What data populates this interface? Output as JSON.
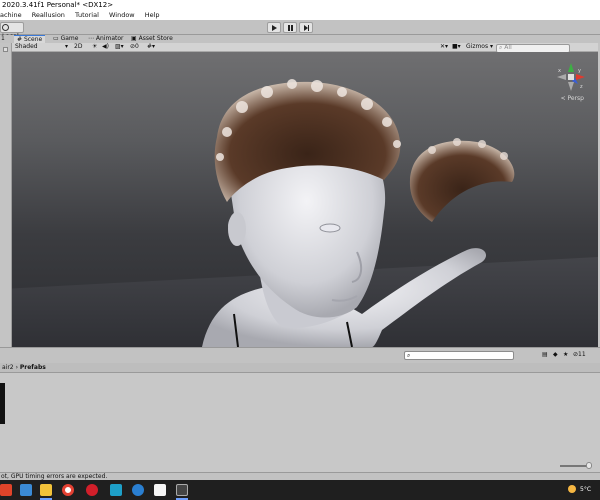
{
  "window": {
    "title": "2020.3.41f1 Personal* <DX12>"
  },
  "menu": {
    "items": [
      "achine",
      "Reallusion",
      "Tutorial",
      "Window",
      "Help"
    ]
  },
  "toolbar": {
    "local_label": "Local",
    "layers_value": "1"
  },
  "tabs": [
    {
      "label": "Scene"
    },
    {
      "label": "Game"
    },
    {
      "label": "Animator"
    },
    {
      "label": "Asset Store"
    }
  ],
  "scene_toolbar": {
    "shading_mode": "Shaded",
    "mode_2d": "2D",
    "hidden_count": "0",
    "gizmos_label": "Gizmos",
    "search_placeholder": "All"
  },
  "viewport": {
    "projection_label": "< Persp"
  },
  "project": {
    "breadcrumb_parent": "air2",
    "breadcrumb_current": "Prefabs",
    "hidden_count": "11"
  },
  "status": {
    "message": "ot, GPU timing errors are expected."
  },
  "taskbar": {
    "temperature": "5°C"
  },
  "colors": {
    "accent": "#3a79d8",
    "viewport_top": "#6f6f71",
    "taskbar": "#1f1f1f"
  }
}
